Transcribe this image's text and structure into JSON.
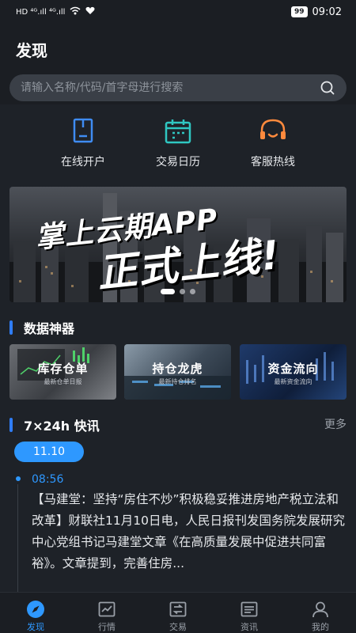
{
  "status_bar": {
    "left": "HD ⁴ᴳ.ıll ⁴ᴳ.ıll",
    "battery": "99",
    "time": "09:02"
  },
  "header": {
    "title": "发现"
  },
  "search": {
    "placeholder": "请输入名称/代码/首字母进行搜索",
    "icon": "search-icon"
  },
  "quick_actions": [
    {
      "label": "在线开户",
      "icon": "account-open-icon",
      "color": "#3f8cf2"
    },
    {
      "label": "交易日历",
      "icon": "calendar-icon",
      "color": "#2fc7c2"
    },
    {
      "label": "客服热线",
      "icon": "headset-icon",
      "color": "#ff8a3d"
    }
  ],
  "banner": {
    "line1": "掌上云期APP",
    "line2": "正式上线!",
    "page_count": 3,
    "active_index": 0
  },
  "data_tools": {
    "title": "数据神器",
    "items": [
      {
        "title": "库存仓单",
        "subtitle": "最新仓单日报"
      },
      {
        "title": "持仓龙虎",
        "subtitle": "最新持仓排名"
      },
      {
        "title": "资金流向",
        "subtitle": "最新资金流向"
      }
    ]
  },
  "news": {
    "title": "7×24h 快讯",
    "more": "更多",
    "date": "11.10",
    "time": "08:56",
    "content": "【马建堂：坚持“房住不炒”积极稳妥推进房地产税立法和改革】财联社11月10日电，人民日报刊发国务院发展研究中心党组书记马建堂文章《在高质量发展中促进共同富裕》。文章提到，完善住房..."
  },
  "tabbar": [
    {
      "label": "发现",
      "icon": "compass-icon",
      "active": true
    },
    {
      "label": "行情",
      "icon": "chart-icon",
      "active": false
    },
    {
      "label": "交易",
      "icon": "trade-icon",
      "active": false
    },
    {
      "label": "资讯",
      "icon": "news-icon",
      "active": false
    },
    {
      "label": "我的",
      "icon": "user-icon",
      "active": false
    }
  ],
  "colors": {
    "accent": "#2e98ff",
    "section_bar": "#2f7df6",
    "background": "#1e2228"
  }
}
